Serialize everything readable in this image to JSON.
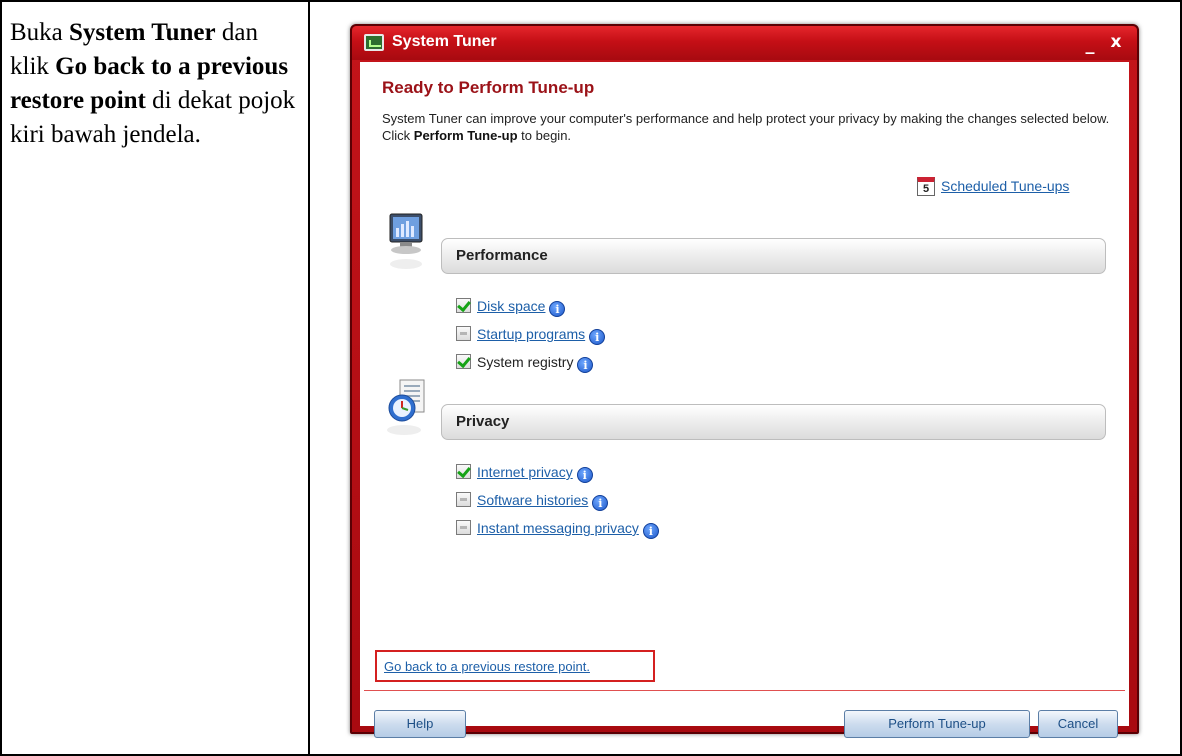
{
  "instruction": {
    "p1": "Buka ",
    "b1": "System Tuner",
    "p2": " dan klik ",
    "b2": "Go back to a previous restore point",
    "p3": "  di dekat pojok kiri bawah jendela."
  },
  "window": {
    "title": "System Tuner",
    "minimize_glyph": "_",
    "close_glyph": "x"
  },
  "content": {
    "heading": "Ready to Perform Tune-up",
    "intro_before": "System Tuner can improve your computer's performance and help protect your privacy by making the changes selected below. Click ",
    "intro_bold": "Perform Tune-up",
    "intro_after": " to begin.",
    "scheduled_icon_day": "5",
    "scheduled_link": "Scheduled Tune-ups"
  },
  "sections": {
    "performance": {
      "title": "Performance",
      "options": [
        {
          "label": "Disk space",
          "checked": true,
          "link": true
        },
        {
          "label": "Startup programs",
          "checked": false,
          "link": true
        },
        {
          "label": "System registry",
          "checked": true,
          "link": false
        }
      ]
    },
    "privacy": {
      "title": "Privacy",
      "options": [
        {
          "label": "Internet privacy",
          "checked": true,
          "link": true
        },
        {
          "label": "Software histories",
          "checked": false,
          "link": true
        },
        {
          "label": "Instant messaging privacy",
          "checked": false,
          "link": true
        }
      ]
    }
  },
  "info_glyph": "i",
  "restore_link": "Go back to a previous restore point.",
  "buttons": {
    "help": "Help",
    "perform": "Perform Tune-up",
    "cancel": "Cancel"
  },
  "colors": {
    "window_red": "#c4141a",
    "heading_red": "#9b1218",
    "link_blue": "#1d5fa8",
    "highlight_red": "#d42020"
  }
}
